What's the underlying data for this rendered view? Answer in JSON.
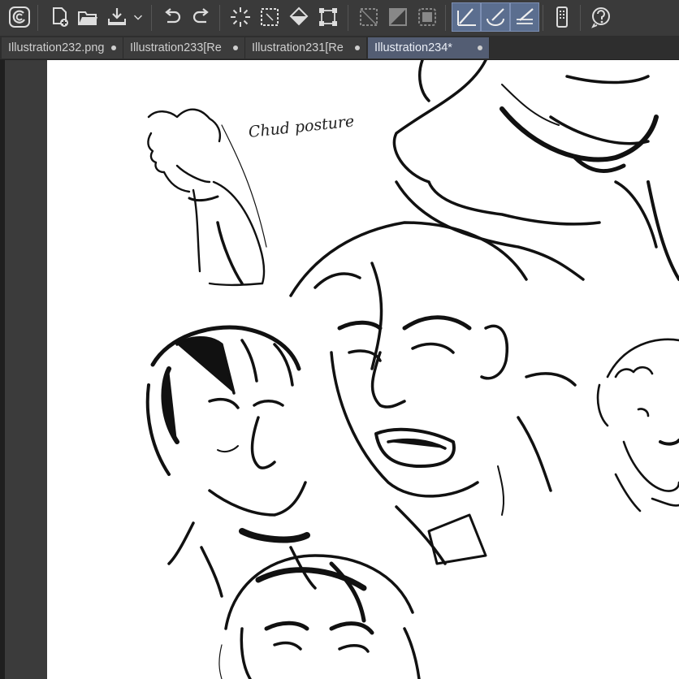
{
  "app": {
    "name": "Clip Studio Paint",
    "colors": {
      "toolbar_bg": "#3a3a3a",
      "active_tool": "#5b6e8f",
      "active_tab": "#535d73",
      "canvas": "#ffffff"
    }
  },
  "toolbar": {
    "buttons": [
      {
        "icon": "clip-studio-logo-icon"
      },
      {
        "icon": "new-file-icon"
      },
      {
        "icon": "open-folder-icon"
      },
      {
        "icon": "save-download-icon"
      },
      {
        "icon": "chevron-down-icon"
      },
      {
        "icon": "undo-icon"
      },
      {
        "icon": "redo-icon"
      },
      {
        "icon": "loading-spinner-icon"
      },
      {
        "icon": "select-all-icon"
      },
      {
        "icon": "fill-bucket-icon"
      },
      {
        "icon": "transform-icon"
      },
      {
        "icon": "clear-selection-icon"
      },
      {
        "icon": "invert-selection-icon"
      },
      {
        "icon": "show-selection-icon"
      },
      {
        "icon": "snap-to-ruler-icon"
      },
      {
        "icon": "snap-to-special-ruler-icon"
      },
      {
        "icon": "snap-to-grid-icon"
      },
      {
        "icon": "companion-mode-icon"
      },
      {
        "icon": "help-icon"
      }
    ]
  },
  "tabs": [
    {
      "label": "Illustration232.png",
      "active": false
    },
    {
      "label": "Illustration233[Re",
      "active": false
    },
    {
      "label": "Illustration231[Re",
      "active": false
    },
    {
      "label": "Illustration234*",
      "active": true
    }
  ],
  "canvas": {
    "handwritten_note": "Chud posture"
  }
}
